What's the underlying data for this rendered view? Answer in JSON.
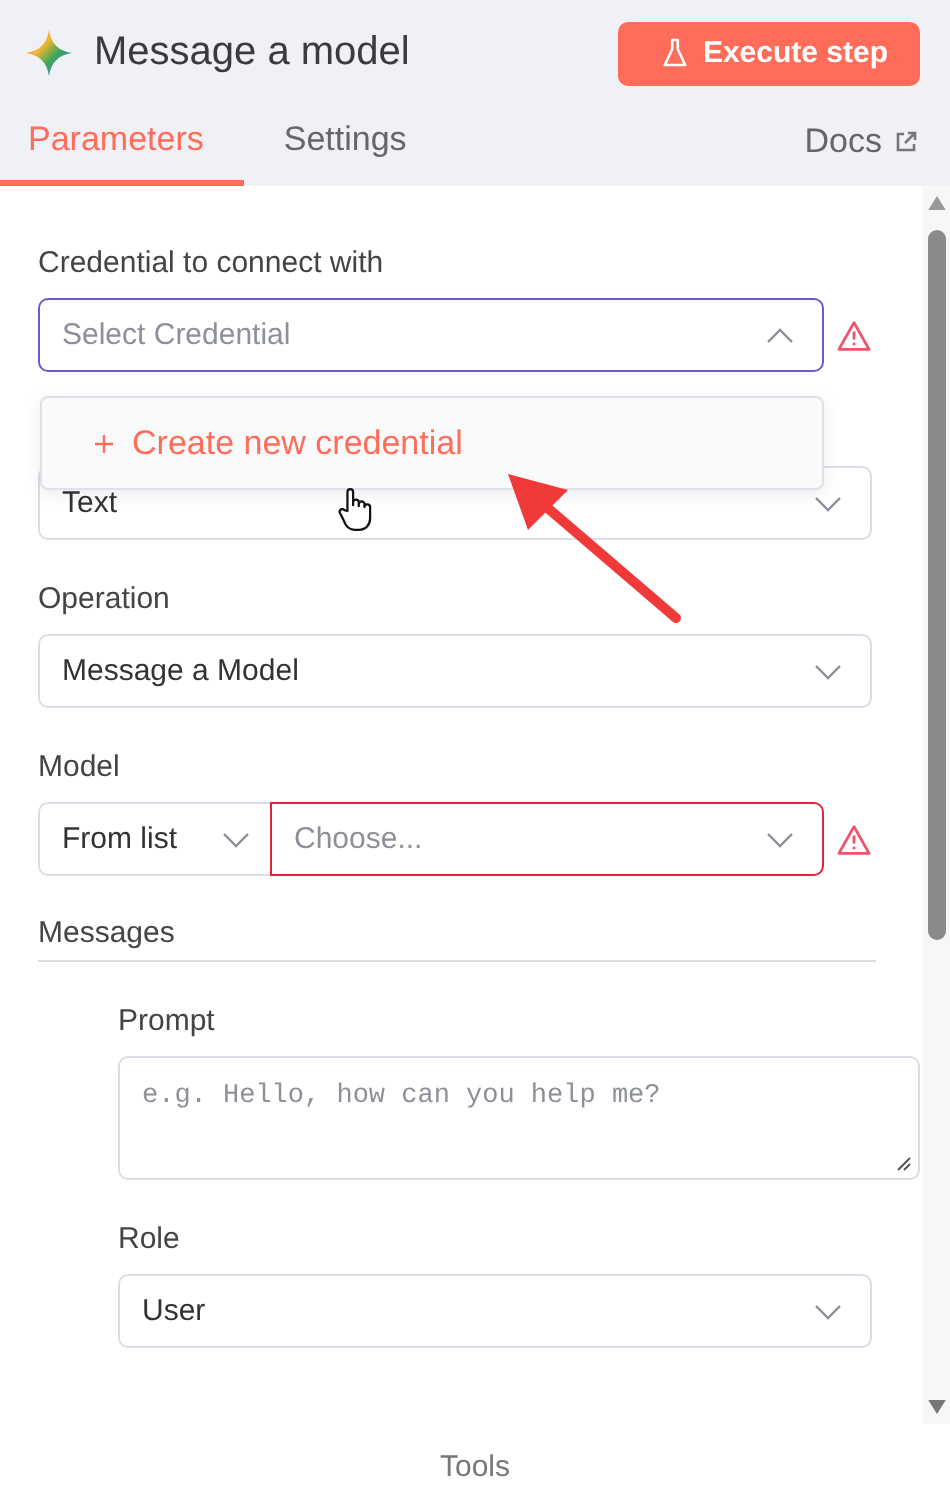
{
  "header": {
    "title": "Message a model",
    "execute_button": "Execute step"
  },
  "tabs": [
    {
      "label": "Parameters",
      "selected": true
    },
    {
      "label": "Settings",
      "selected": false
    }
  ],
  "docs_link": "Docs",
  "fields": [
    {
      "kind": "select",
      "label": "Credential to connect with",
      "placeholder": "Select Credential",
      "focused": true,
      "error": false,
      "warning": true,
      "expanded": true,
      "menu": [
        "Create new credential"
      ]
    },
    {
      "kind": "select",
      "value": "Text",
      "focused": false,
      "error": false,
      "warning": false,
      "expanded": false
    },
    {
      "kind": "select",
      "label": "Operation",
      "value": "Message a Model",
      "focused": false,
      "error": false,
      "warning": false,
      "expanded": false
    },
    {
      "kind": "resource",
      "label": "Model",
      "mode": "From list",
      "placeholder": "Choose...",
      "focused": false,
      "error": true,
      "warning": true,
      "expanded": false
    },
    {
      "kind": "section",
      "label": "Messages",
      "children": [
        {
          "kind": "textarea",
          "label": "Prompt",
          "placeholder": "e.g. Hello, how can you help me?",
          "focused": false,
          "error": false,
          "warning": false
        },
        {
          "kind": "select",
          "label": "Role",
          "value": "User",
          "focused": false,
          "error": false,
          "warning": false,
          "expanded": false
        }
      ]
    }
  ],
  "footer": "Tools"
}
